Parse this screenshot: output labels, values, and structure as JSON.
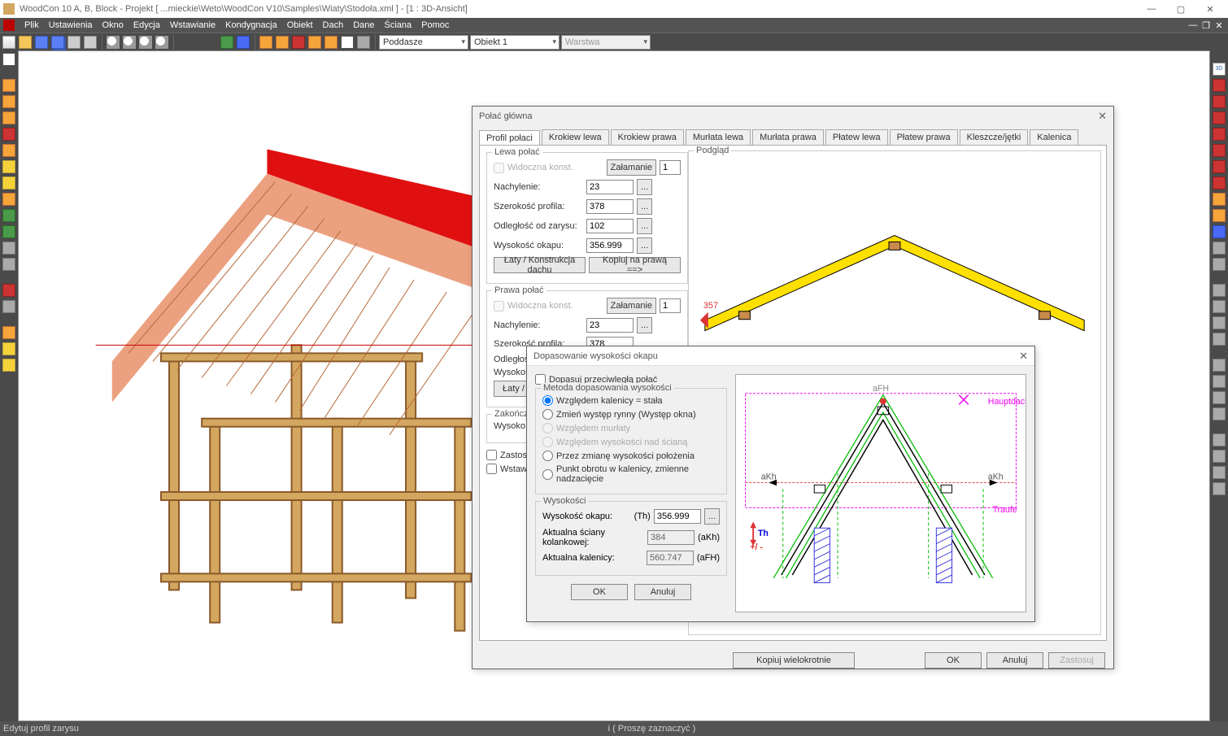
{
  "app": {
    "title": "WoodCon 10 A, B, Block - Projekt [ ...mieckie\\Weto\\WoodCon V10\\Samples\\Wiaty\\Stodoła.xml ]  - [1 : 3D-Ansicht]"
  },
  "menu": {
    "items": [
      "Plik",
      "Ustawienia",
      "Okno",
      "Edycja",
      "Wstawianie",
      "Kondygnacja",
      "Obiekt",
      "Dach",
      "Dane",
      "Ściana",
      "Pomoc"
    ]
  },
  "toolbar": {
    "combo1": "Poddasze",
    "combo2": "Obiekt 1",
    "combo3": "Warstwa"
  },
  "status": {
    "left": "Edytuj profil zarysu",
    "mid": "i ( Proszę zaznaczyć )"
  },
  "dlg1": {
    "title": "Połać główna",
    "tabs": [
      "Profil połaci",
      "Krokiew lewa",
      "Krokiew prawa",
      "Murłata lewa",
      "Murłata prawa",
      "Płatew lewa",
      "Płatew prawa",
      "Kleszcze/jętki",
      "Kalenica"
    ],
    "active_tab": 0,
    "lewa": {
      "legend": "Lewa połać",
      "widoczna": "Widoczna konst.",
      "zalamanie": "Załamanie",
      "nachylenie_lbl": "Nachylenie:",
      "nachylenie_val": "23",
      "szer_lbl": "Szerokość profila:",
      "szer_val": "378",
      "odl_lbl": "Odległość od zarysu:",
      "odl_val": "102",
      "wys_lbl": "Wysokość okapu:",
      "wys_val": "356.999",
      "laty": "Łaty / Konstrukcja dachu",
      "kopiuj": "Kopiuj na prawą ==>"
    },
    "prawa": {
      "legend": "Prawa połać",
      "widoczna": "Widoczna konst.",
      "zalamanie": "Załamanie",
      "nachylenie_lbl": "Nachylenie:",
      "nachylenie_val": "23",
      "szer_lbl": "Szerokość profila:",
      "szer_val": "378",
      "odl_lbl": "Odległoś",
      "wys_lbl": "Wysokoś",
      "laty": "Łaty / Kon"
    },
    "zakon": {
      "legend": "Zakończ",
      "wys_lbl": "Wysoko"
    },
    "chk1": "Zastosuj",
    "chk2": "Wstaw w",
    "preview_label": "Podgląd",
    "preview_marker": "357",
    "buttons": {
      "kopiuj": "Kopiuj wielokrotnie",
      "ok": "OK",
      "anuluj": "Anuluj",
      "zastosuj": "Zastosuj"
    }
  },
  "dlg2": {
    "title": "Dopasowanie wysokości okapu",
    "chk_opp": "Dopasuj przeciwległą połać",
    "method": {
      "legend": "Metoda dopasowania wysokości",
      "r1": "Względem kalenicy = stała",
      "r2": "Zmień występ rynny (Występ okna)",
      "r3": "Względem murłaty",
      "r4": "Względem wysokości nad ścianą",
      "r5": "Przez zmianę wysokości położenia",
      "r6": "Punkt obrotu w kalenicy, zmienne nadzacięcie"
    },
    "heights": {
      "legend": "Wysokości",
      "okap_lbl": "Wysokość okapu:",
      "okap_sym": "(Th)",
      "okap_val": "356.999",
      "dots": "...",
      "kol_lbl": "Aktualna ściany kolankowej:",
      "kol_val": "384",
      "kol_sym": "(aKh)",
      "kal_lbl": "Aktualna kalenicy:",
      "kal_val": "560.747",
      "kal_sym": "(aFH)"
    },
    "buttons": {
      "ok": "OK",
      "anuluj": "Anuluj"
    },
    "diagram": {
      "afh": "aFH",
      "akh": "aKh",
      "haupt": "Hauptdach",
      "traufe": "Traufe",
      "th": "Th",
      "pm": "+/ -"
    }
  }
}
